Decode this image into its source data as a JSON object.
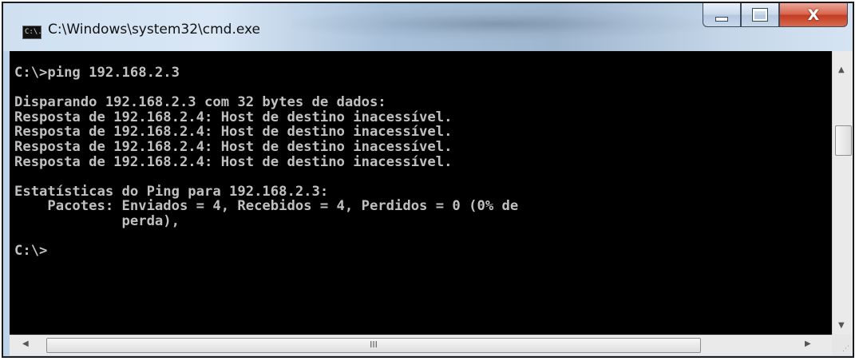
{
  "window": {
    "title": "C:\\Windows\\system32\\cmd.exe",
    "icon_label": "C:\\.",
    "icons": {
      "app": "cmd-icon",
      "minimize": "minimize-icon",
      "maximize": "maximize-icon",
      "close": "close-icon",
      "close_glyph": "X"
    }
  },
  "console": {
    "lines": [
      "C:\\>ping 192.168.2.3",
      "",
      "Disparando 192.168.2.3 com 32 bytes de dados:",
      "Resposta de 192.168.2.4: Host de destino inacessível.",
      "Resposta de 192.168.2.4: Host de destino inacessível.",
      "Resposta de 192.168.2.4: Host de destino inacessível.",
      "Resposta de 192.168.2.4: Host de destino inacessível.",
      "",
      "Estatísticas do Ping para 192.168.2.3:",
      "    Pacotes: Enviados = 4, Recebidos = 4, Perdidos = 0 (0% de",
      "             perda),",
      "",
      "C:\\>"
    ],
    "colors": {
      "background": "#000000",
      "text": "#c0c0c0"
    }
  },
  "scrollbars": {
    "up_arrow": "▲",
    "down_arrow": "▼",
    "left_arrow": "◀",
    "right_arrow": "▶",
    "thumb_grip": "III",
    "resize_grip": "⋰"
  },
  "colors": {
    "close_button": "#c84a30",
    "titlebar": "#bcd3ea"
  }
}
